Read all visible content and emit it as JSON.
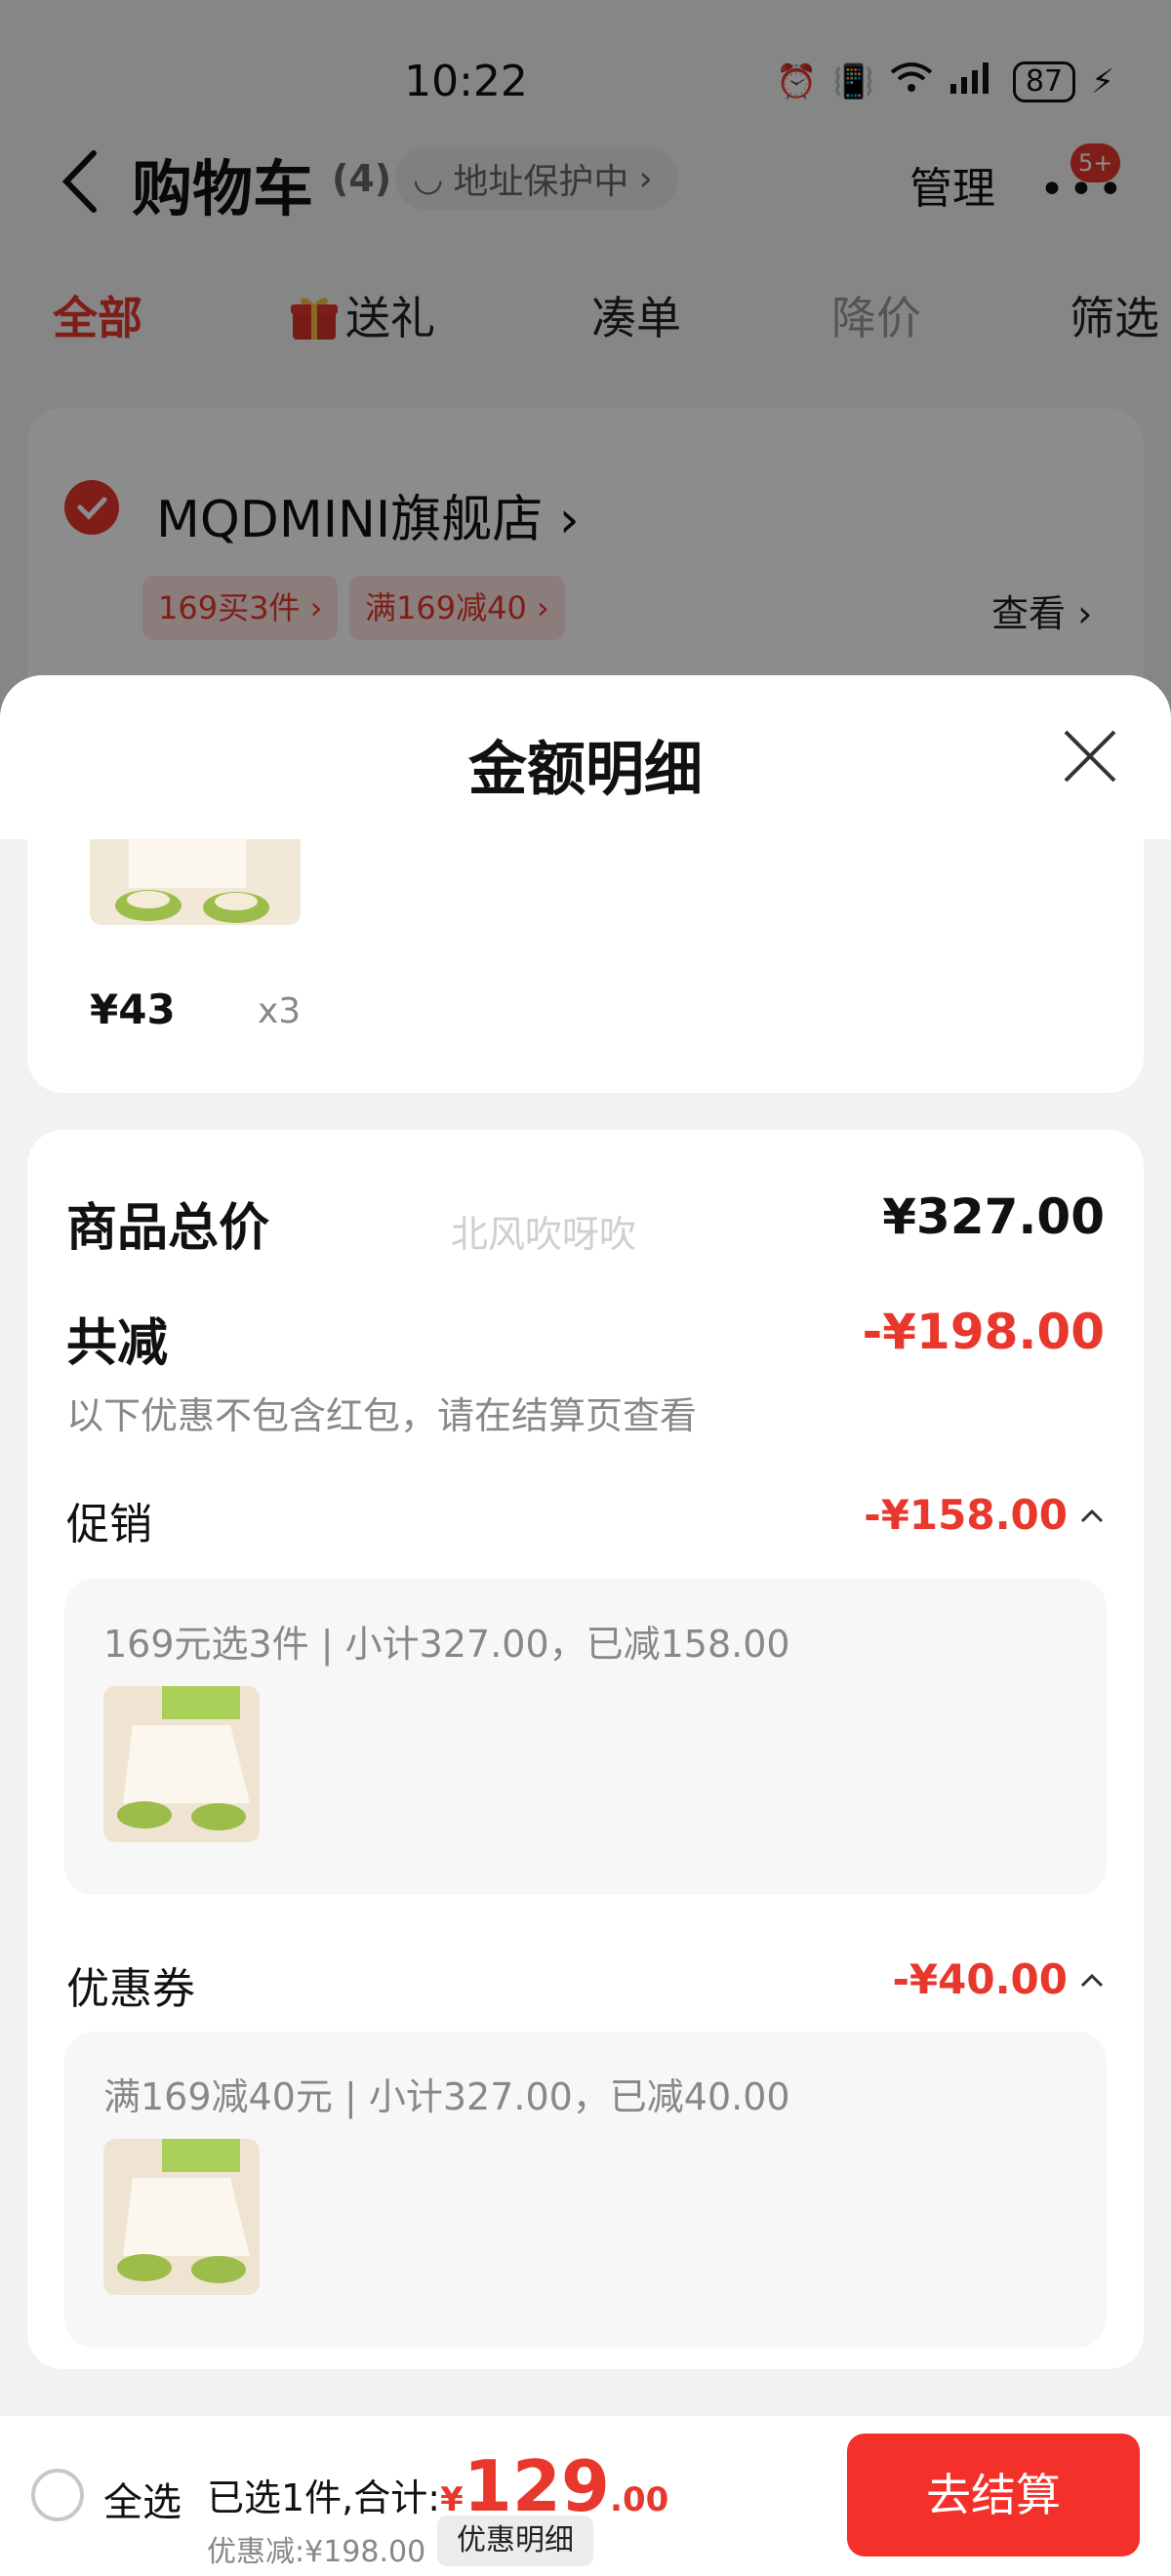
{
  "status": {
    "time": "10:22",
    "battery": "87"
  },
  "nav": {
    "title": "购物车",
    "count": "(4)",
    "address_pill": "地址保护中",
    "manage": "管理",
    "badge": "5+"
  },
  "tabs": [
    "全部",
    "送礼",
    "凑单",
    "降价",
    "筛选"
  ],
  "store": {
    "name": "MQDMINI旗舰店",
    "promo_tags": [
      "169买3件",
      "满169减40"
    ],
    "view": "查看"
  },
  "sheet": {
    "title": "金额明细",
    "goods": {
      "price": "¥43",
      "qty": "x3"
    },
    "total_label": "商品总价",
    "total_value": "¥327.00",
    "watermark": "北风吹呀吹",
    "reduce_label": "共减",
    "reduce_value": "-¥198.00",
    "note": "以下优惠不包含红包，请在结算页查看",
    "promo": {
      "label": "促销",
      "value": "-¥158.00",
      "detail": "169元选3件 | 小计327.00，已减158.00"
    },
    "coupon": {
      "label": "优惠券",
      "value": "-¥40.00",
      "detail": "满169减40元 | 小计327.00，已减40.00"
    }
  },
  "bottom": {
    "select_all": "全选",
    "summary_prefix": "已选1件,合计:",
    "yen": "¥",
    "total_int": "129",
    "total_dec": ".00",
    "discount": "优惠减:¥198.00",
    "detail_button": "优惠明细",
    "checkout": "去结算"
  },
  "colors": {
    "accent": "#e8372c",
    "checkout": "#f3302a"
  }
}
